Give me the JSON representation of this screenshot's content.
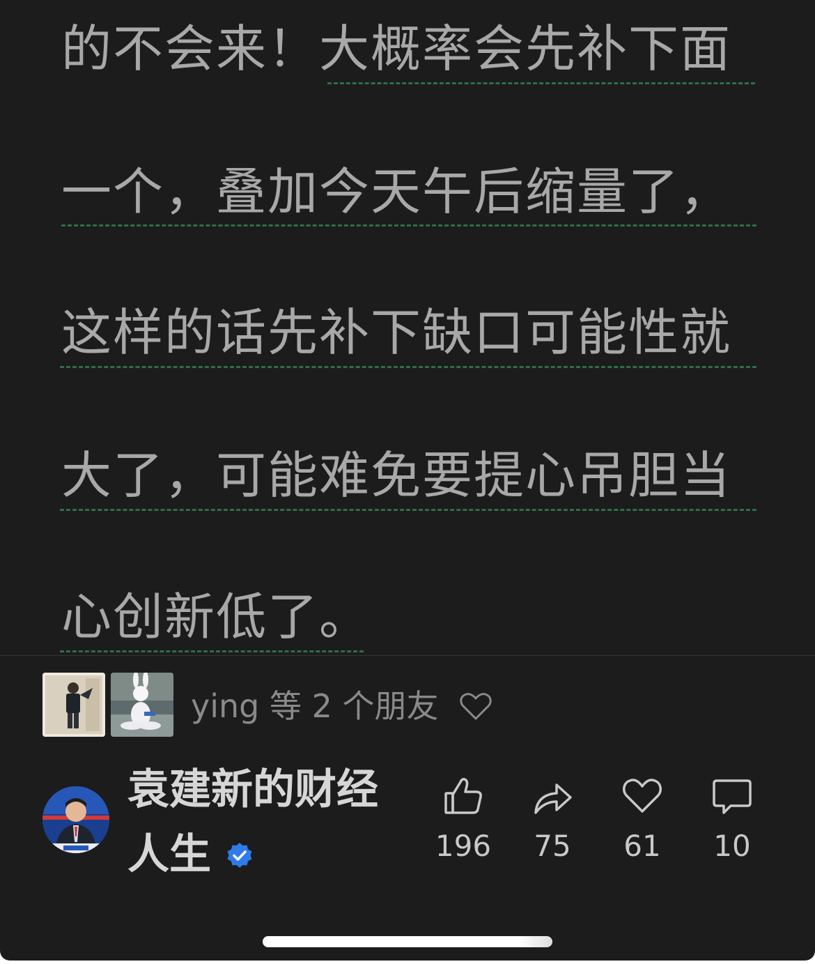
{
  "article": {
    "lines": [
      "的不会来！大概率会先补下面",
      "一个，叠加今天午后缩量了，",
      "这样的话先补下缺口可能性就",
      "大了，可能难免要提心吊胆当",
      "心创新低了。"
    ]
  },
  "friends": {
    "text": "ying 等 2 个朋友",
    "icon": "heart-outline-icon"
  },
  "author": {
    "name_line1": "袁建新的财经",
    "name_line2": "人生",
    "verified_icon": "verified-badge-icon",
    "avatar_icon": "avatar-news-anchor"
  },
  "actions": {
    "like": {
      "count": "196",
      "icon": "thumb-up-icon"
    },
    "share": {
      "count": "75",
      "icon": "share-arrow-icon"
    },
    "favorite": {
      "count": "61",
      "icon": "heart-icon"
    },
    "comment": {
      "count": "10",
      "icon": "comment-bubble-icon"
    }
  },
  "colors": {
    "background": "#1c1c1c",
    "text": "#a8a8a8",
    "underline": "#2f6e46",
    "verified": "#2f7bea"
  }
}
